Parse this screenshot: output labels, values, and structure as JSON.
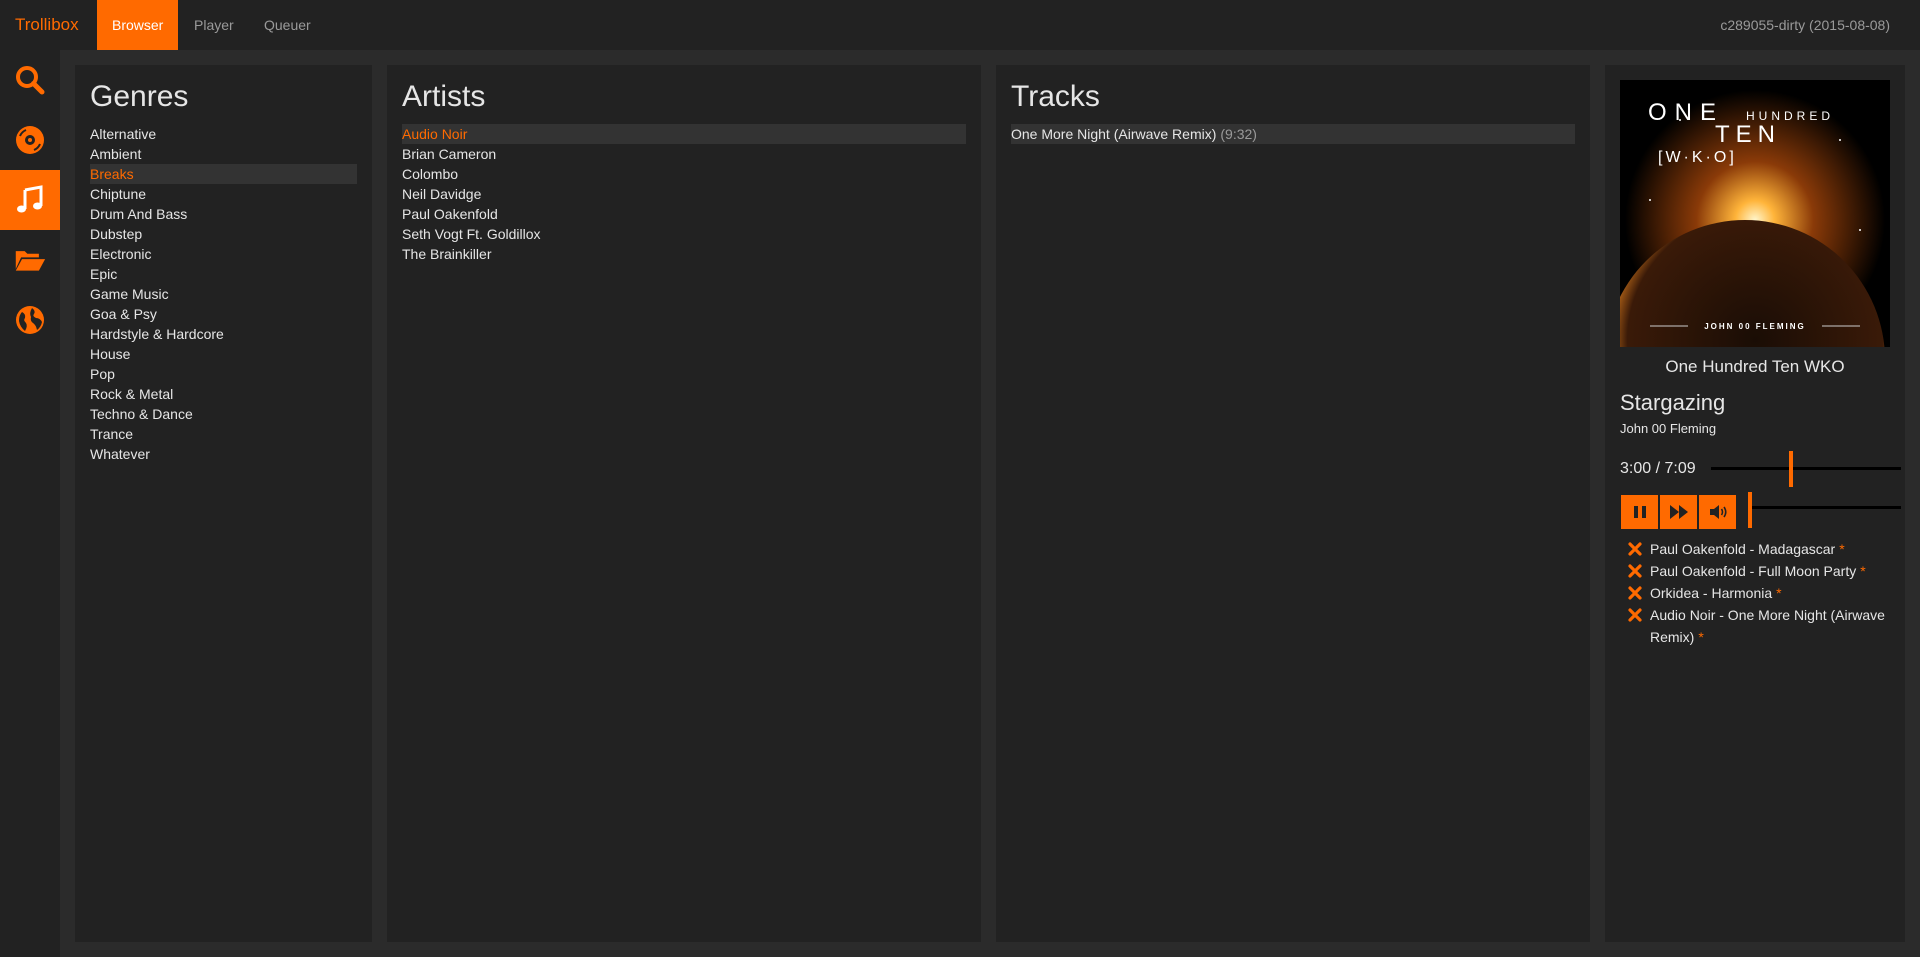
{
  "navbar": {
    "brand": "Trollibox",
    "tabs": [
      {
        "label": "Browser",
        "active": true
      },
      {
        "label": "Player",
        "active": false
      },
      {
        "label": "Queuer",
        "active": false
      }
    ],
    "version": "c289055-dirty (2015-08-08)"
  },
  "sidebar": {
    "items": [
      {
        "icon": "search-icon",
        "active": false
      },
      {
        "icon": "disc-icon",
        "active": false
      },
      {
        "icon": "music-note-icon",
        "active": true
      },
      {
        "icon": "folder-open-icon",
        "active": false
      },
      {
        "icon": "globe-icon",
        "active": false
      }
    ]
  },
  "genres": {
    "title": "Genres",
    "selected": "Breaks",
    "items": [
      "Alternative",
      "Ambient",
      "Breaks",
      "Chiptune",
      "Drum And Bass",
      "Dubstep",
      "Electronic",
      "Epic",
      "Game Music",
      "Goa & Psy",
      "Hardstyle & Hardcore",
      "House",
      "Pop",
      "Rock & Metal",
      "Techno & Dance",
      "Trance",
      "Whatever"
    ]
  },
  "artists": {
    "title": "Artists",
    "selected": "Audio Noir",
    "items": [
      "Audio Noir",
      "Brian Cameron",
      "Colombo",
      "Neil Davidge",
      "Paul Oakenfold",
      "Seth Vogt Ft. Goldillox",
      "The Brainkiller"
    ]
  },
  "tracks": {
    "title": "Tracks",
    "items": [
      {
        "title": "One More Night (Airwave Remix)",
        "duration": "(9:32)"
      }
    ]
  },
  "player": {
    "cover": {
      "line1": "ONE",
      "line1b": "HUNDRED",
      "line2": "TEN",
      "line3": "[W·K·O]",
      "artist": "JOHN 00 FLEMING"
    },
    "album": "One Hundred Ten WKO",
    "title": "Stargazing",
    "artist": "John 00 Fleming",
    "time": "3:00 / 7:09",
    "progress": 0.42,
    "volume": 0.0,
    "controls": [
      "pause-icon",
      "fast-forward-icon",
      "volume-icon"
    ],
    "accent": "#ff6a00"
  },
  "queue": [
    {
      "text": "Paul Oakenfold - Madagascar",
      "mark": "*"
    },
    {
      "text": "Paul Oakenfold - Full Moon Party",
      "mark": "*"
    },
    {
      "text": "Orkidea - Harmonia",
      "mark": "*"
    },
    {
      "text": "Audio Noir - One More Night (Airwave Remix)",
      "mark": "*"
    }
  ]
}
